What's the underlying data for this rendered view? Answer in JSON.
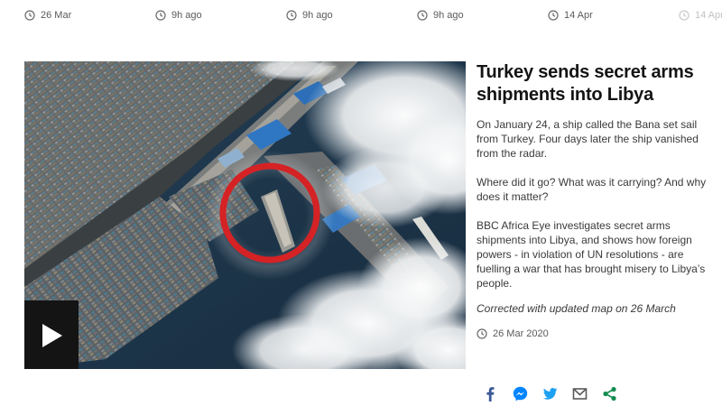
{
  "top_timestamps": [
    {
      "icon": "clock-icon",
      "text": "26 Mar"
    },
    {
      "icon": "clock-icon",
      "text": "9h ago"
    },
    {
      "icon": "clock-icon",
      "text": "9h ago"
    },
    {
      "icon": "clock-icon",
      "text": "9h ago"
    },
    {
      "icon": "clock-icon",
      "text": "14 Apr"
    },
    {
      "icon": "clock-icon",
      "text": "14 Apr"
    }
  ],
  "media": {
    "play_icon": "play-icon"
  },
  "article": {
    "headline": "Turkey sends secret arms shipments into Libya",
    "paragraphs": [
      "On January 24, a ship called the Bana set sail from Turkey. Four days later the ship vanished from the radar.",
      "Where did it go? What was it carrying? And why does it matter?",
      "BBC Africa Eye investigates secret arms shipments into Libya, and shows how foreign powers - in violation of UN resolutions - are fuelling a war that has brought misery to Libya’s people."
    ],
    "correction": "Corrected with updated map on 26 March",
    "date": "26 Mar 2020",
    "date_icon": "clock-icon"
  },
  "share": [
    {
      "name": "facebook-icon",
      "color": "#3b5998"
    },
    {
      "name": "messenger-icon",
      "color": "#0084ff"
    },
    {
      "name": "twitter-icon",
      "color": "#1da1f2"
    },
    {
      "name": "email-icon",
      "color": "#5a5a5a"
    },
    {
      "name": "share-icon",
      "color": "#128c4e"
    }
  ]
}
